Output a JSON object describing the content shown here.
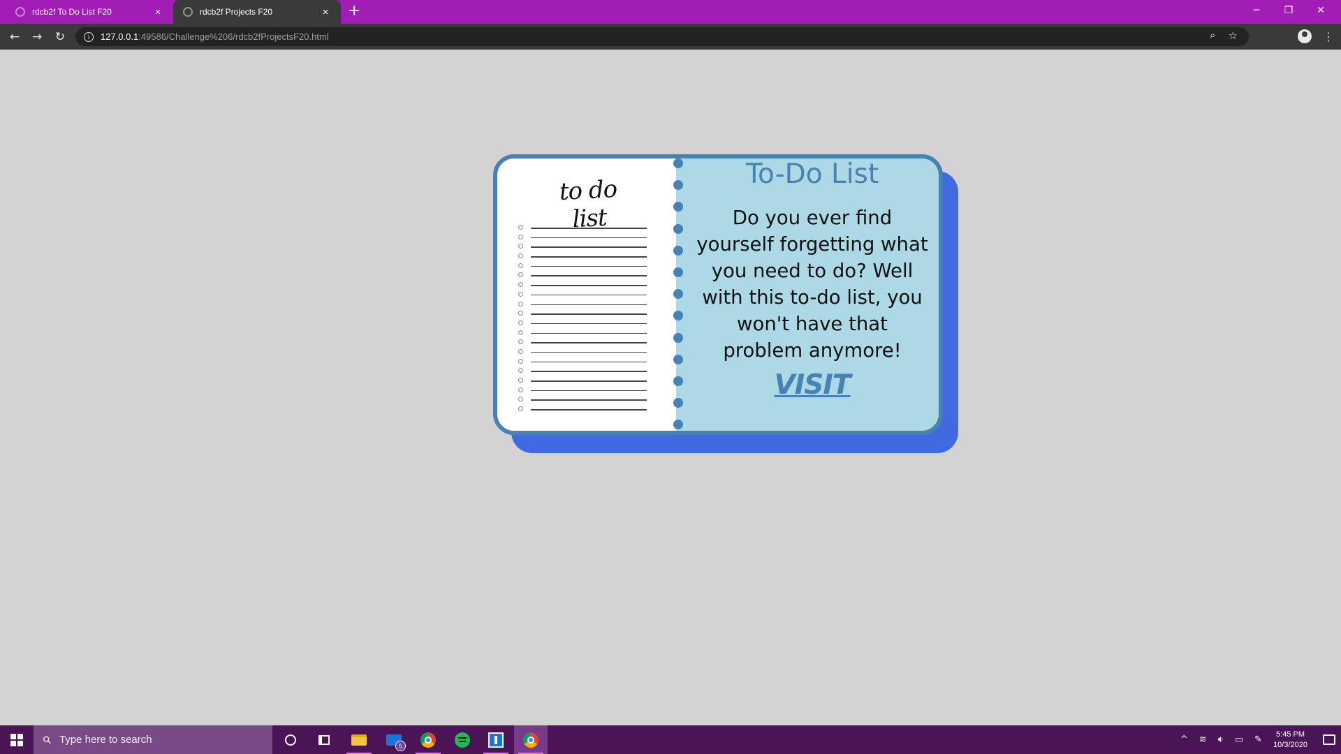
{
  "browser": {
    "tabs": [
      {
        "title": "rdcb2f To Do List F20",
        "close": "×",
        "active": false
      },
      {
        "title": "rdcb2f Projects F20",
        "close": "×",
        "active": true
      }
    ],
    "new_tab": "+",
    "window_controls": {
      "minimize": "─",
      "maximize": "❐",
      "close": "✕"
    },
    "nav": {
      "back": "←",
      "forward": "→",
      "reload": "↻"
    },
    "address": {
      "info": "i",
      "host": "127.0.0.1",
      "path": ":49586/Challenge%206/rdcb2fProjectsF20.html"
    },
    "omnibox_icons": {
      "zoom": "⌕",
      "bookmark": "☆"
    },
    "menu": "⋮"
  },
  "card": {
    "notepad_title": "to do list",
    "notepad_row_count": 20,
    "spiral_ring_count": 13,
    "title": "To-Do List",
    "description": "Do you ever find yourself forgetting what you need to do? Well with this to-do list, you won't have that problem anymore!",
    "link": "VISIT"
  },
  "taskbar": {
    "search_placeholder": "Type here to search",
    "mail_badge": "5",
    "clock_time": "5:45 PM",
    "clock_date": "10/3/2020",
    "tray_icons": [
      "chevron-up-icon",
      "network-icon",
      "volume-icon",
      "battery-icon",
      "pen-icon"
    ],
    "tray_glyphs": {
      "chevron": "^",
      "network": "≋",
      "volume": "🔉︎",
      "battery": "▭",
      "pen": "✎"
    }
  },
  "colors": {
    "tab_bar": "#a21cb6",
    "toolbar": "#3a3a3a",
    "page_bg": "#d3d3d3",
    "card_bg": "#add8e6",
    "card_border": "#4682b4",
    "card_shadow": "#4169e1",
    "taskbar": "#4a1457"
  }
}
